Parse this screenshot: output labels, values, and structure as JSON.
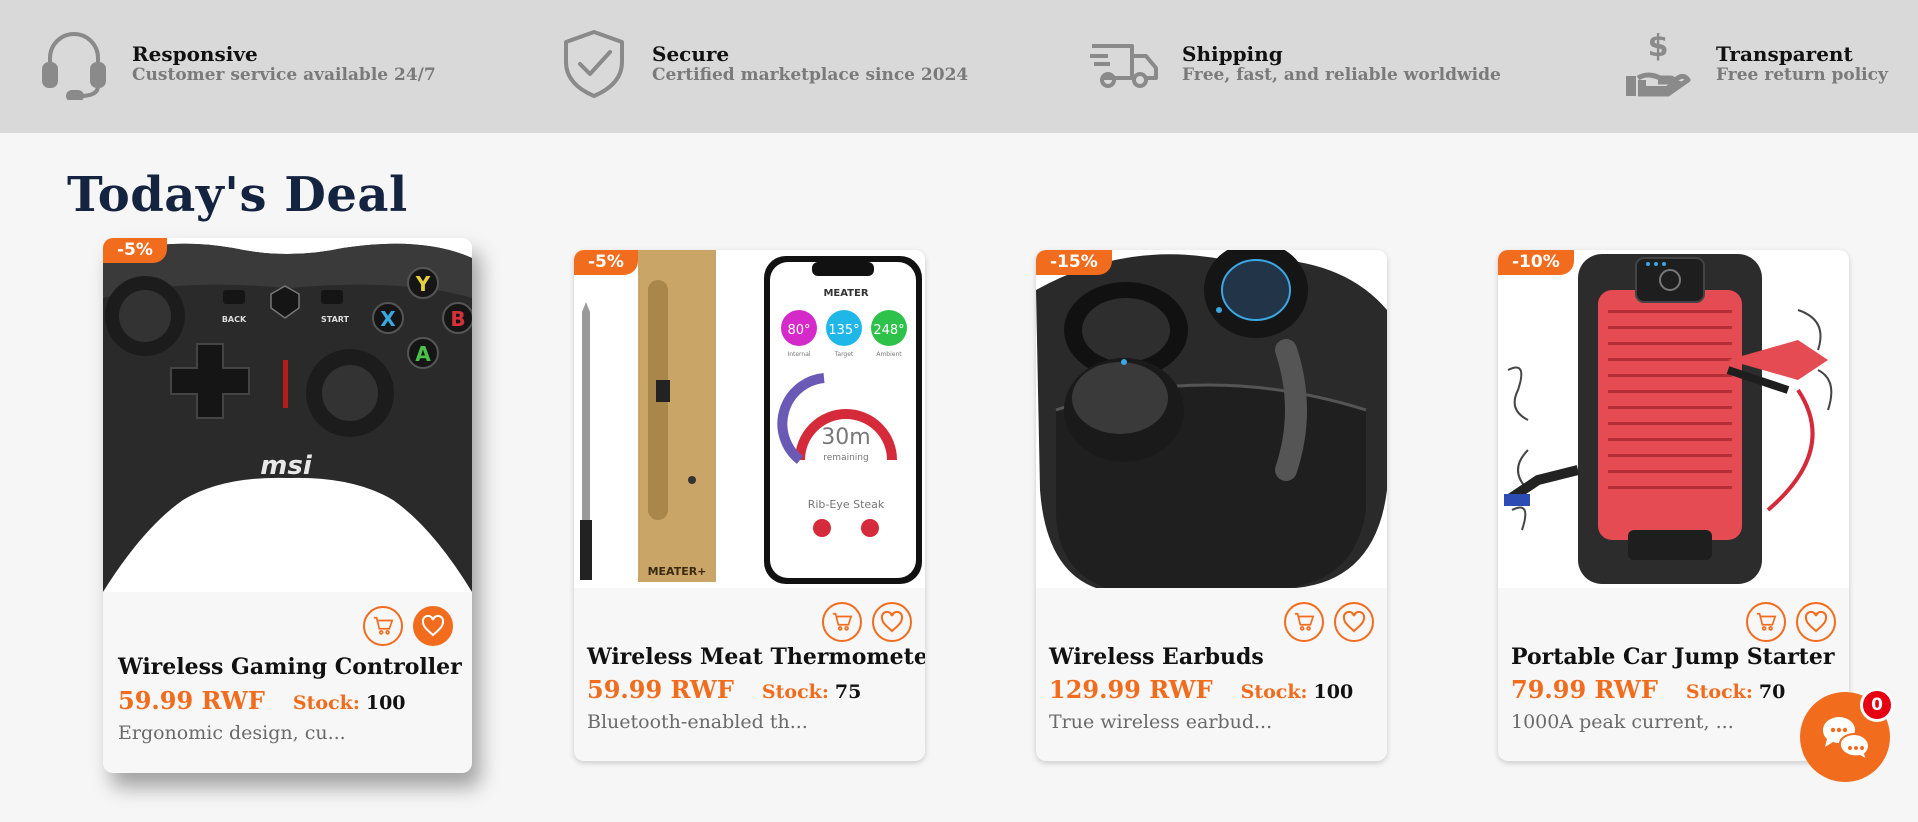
{
  "features": [
    {
      "icon": "headset-icon",
      "title": "Responsive",
      "subtitle": "Customer service available 24/7"
    },
    {
      "icon": "shield-check-icon",
      "title": "Secure",
      "subtitle": "Certified marketplace since 2024"
    },
    {
      "icon": "truck-icon",
      "title": "Shipping",
      "subtitle": "Free, fast, and reliable worldwide"
    },
    {
      "icon": "hand-dollar-icon",
      "title": "Transparent",
      "subtitle": "Free return policy"
    }
  ],
  "deals": {
    "title": "Today's Deal",
    "products": [
      {
        "name": "Wireless Gaming Controller",
        "price": "59.99 RWF",
        "stock_label": "Stock:",
        "stock": "100",
        "discount": "-5%",
        "description": "Ergonomic design, cu...",
        "image": "game-controller-image",
        "favorited": true
      },
      {
        "name": "Wireless Meat Thermometer",
        "price": "59.99 RWF",
        "stock_label": "Stock:",
        "stock": "75",
        "discount": "-5%",
        "description": "Bluetooth-enabled th...",
        "image": "meat-thermometer-image",
        "favorited": false
      },
      {
        "name": "Wireless Earbuds",
        "price": "129.99 RWF",
        "stock_label": "Stock:",
        "stock": "100",
        "discount": "-15%",
        "description": "True wireless earbud...",
        "image": "earbuds-image",
        "favorited": false
      },
      {
        "name": "Portable Car Jump Starter",
        "price": "79.99 RWF",
        "stock_label": "Stock:",
        "stock": "70",
        "discount": "-10%",
        "description": "1000A peak current, ...",
        "image": "jump-starter-image",
        "favorited": false
      }
    ]
  },
  "thermometer_screen": {
    "brand": "MEATER",
    "internal": "80°",
    "target": "135°",
    "ambient": "248°",
    "internal_label": "Internal",
    "target_label": "Target",
    "ambient_label": "Ambient",
    "time": "30m",
    "remaining": "remaining",
    "cut": "Rib-Eye Steak",
    "box_brand": "MEATER+"
  },
  "controller_labels": {
    "back": "BACK",
    "start": "START",
    "brand": "msi",
    "y": "Y",
    "x": "X",
    "b": "B",
    "a": "A"
  },
  "chat": {
    "icon": "chat-icon",
    "count": "0"
  },
  "colors": {
    "accent": "#f26c1e",
    "heading": "#14233f",
    "strip": "#d9d9d9"
  }
}
